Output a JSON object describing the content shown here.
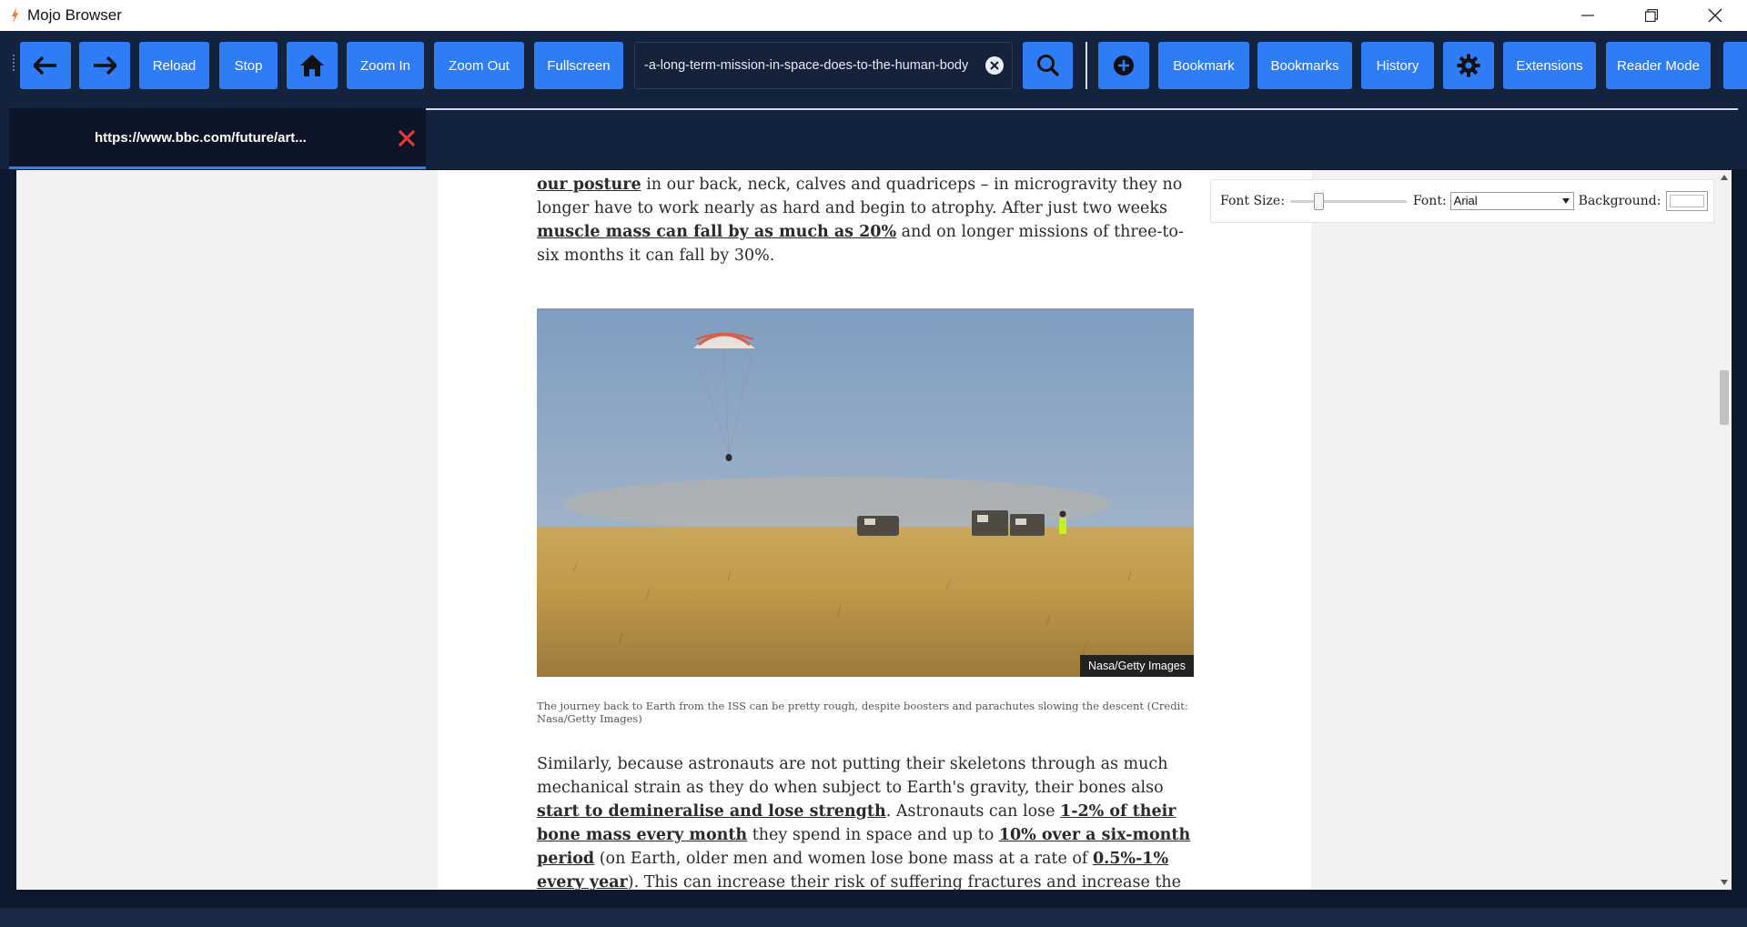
{
  "window": {
    "title": "Mojo Browser"
  },
  "toolbar": {
    "reload": "Reload",
    "stop": "Stop",
    "zoom_in": "Zoom In",
    "zoom_out": "Zoom Out",
    "fullscreen": "Fullscreen",
    "url": "-a-long-term-mission-in-space-does-to-the-human-body",
    "bookmark": "Bookmark",
    "bookmarks": "Bookmarks",
    "history": "History",
    "extensions": "Extensions",
    "reader_mode": "Reader Mode",
    "icons": [
      "back-arrow-icon",
      "forward-arrow-icon",
      "home-icon",
      "clear-icon",
      "search-icon",
      "plus-circle-icon",
      "gear-icon"
    ]
  },
  "tabs": [
    {
      "label": "https://www.bbc.com/future/art...",
      "active": true
    }
  ],
  "reader_controls": {
    "font_size_label": "Font Size:",
    "font_size_level": 0.22,
    "font_label": "Font:",
    "font_value": "Arial",
    "background_label": "Background:"
  },
  "article": {
    "para1": {
      "link1": "our posture",
      "text1": " in our back, neck, calves and quadriceps – in microgravity they no longer have to work nearly as hard and begin to atrophy. After just two weeks ",
      "link2": "muscle mass can fall by as much as 20%",
      "text2": " and on longer missions of three-to-six months it can fall by 30%."
    },
    "image_credit": "Nasa/Getty Images",
    "caption": "The journey back to Earth from the ISS can be pretty rough, despite boosters and parachutes slowing the descent (Credit: Nasa/Getty Images)",
    "para2": {
      "text1": "Similarly, because astronauts are not putting their skeletons through as much mechanical strain as they do when subject to Earth's gravity, their bones also ",
      "link1": "start to demineralise and lose strength",
      "text2": ". Astronauts can lose ",
      "link2": "1-2% of their bone mass every month",
      "text3": " they spend in space and up to ",
      "link3": "10% over a six-month period",
      "text4": " (on Earth, older men and women lose bone mass at a rate of ",
      "link4": "0.5%-1% every year",
      "text5": "). This can increase their risk of suffering fractures and increase the amount of time it takes to heal. It can"
    }
  },
  "colors": {
    "chrome": "#13233d",
    "button": "#2f7df6",
    "tab_close": "#e53935"
  }
}
